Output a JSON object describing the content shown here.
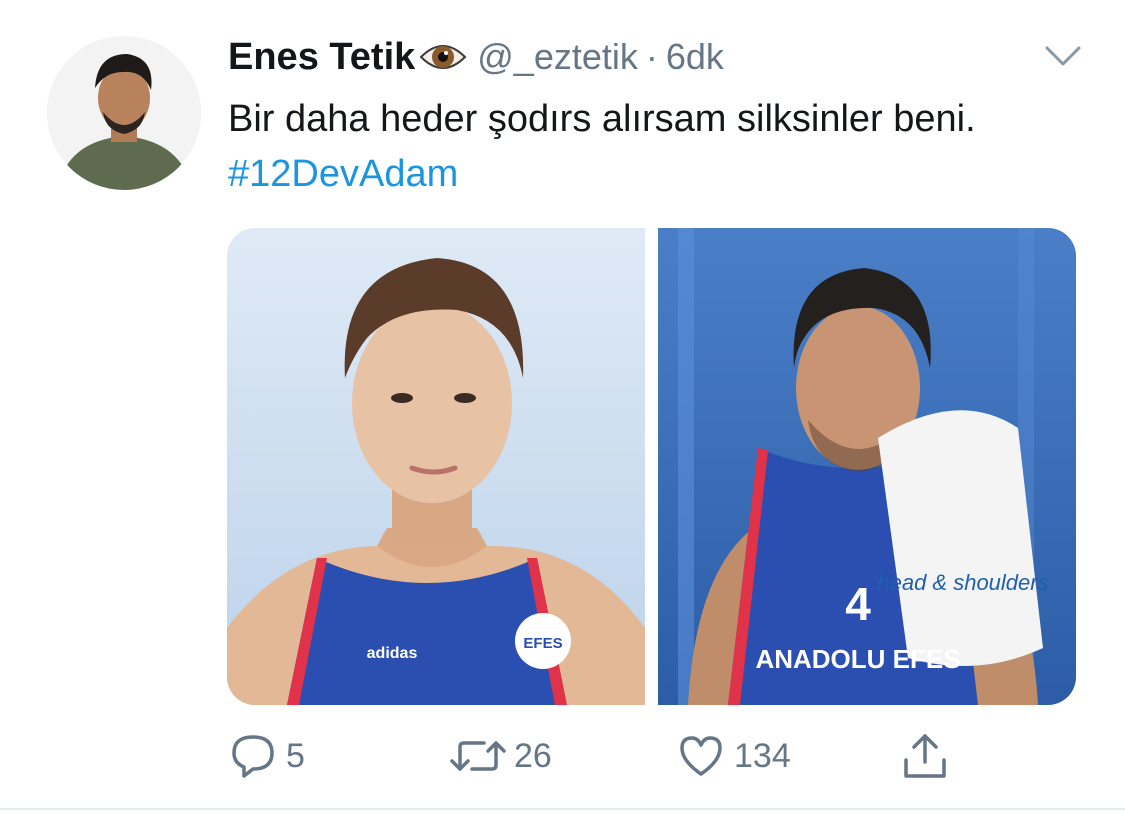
{
  "tweet": {
    "author": {
      "display_name": "Enes Tetik",
      "handle": "@_eztetik",
      "name_emoji": "eye-emoji",
      "avatar": "profile-photo"
    },
    "separator": "·",
    "time_ago": "6dk",
    "text": "Bir daha heder şodırs alırsam silksinler beni.",
    "hashtag": "#12DevAdam",
    "media": [
      {
        "type": "photo",
        "description": "basketball-player-portrait-blue-jersey",
        "visible_text": [
          "adidas"
        ]
      },
      {
        "type": "photo",
        "description": "basketball-player-with-towel",
        "visible_text": [
          "head & shoulders",
          "ANADOLU EFES",
          "4"
        ]
      }
    ],
    "actions": {
      "reply_count": "5",
      "retweet_count": "26",
      "like_count": "134"
    }
  },
  "colors": {
    "link": "#1b95e0",
    "secondary_text": "#657786",
    "icon": "#657786",
    "jersey_blue": "#2a4fb0",
    "jersey_red": "#e0334a"
  }
}
